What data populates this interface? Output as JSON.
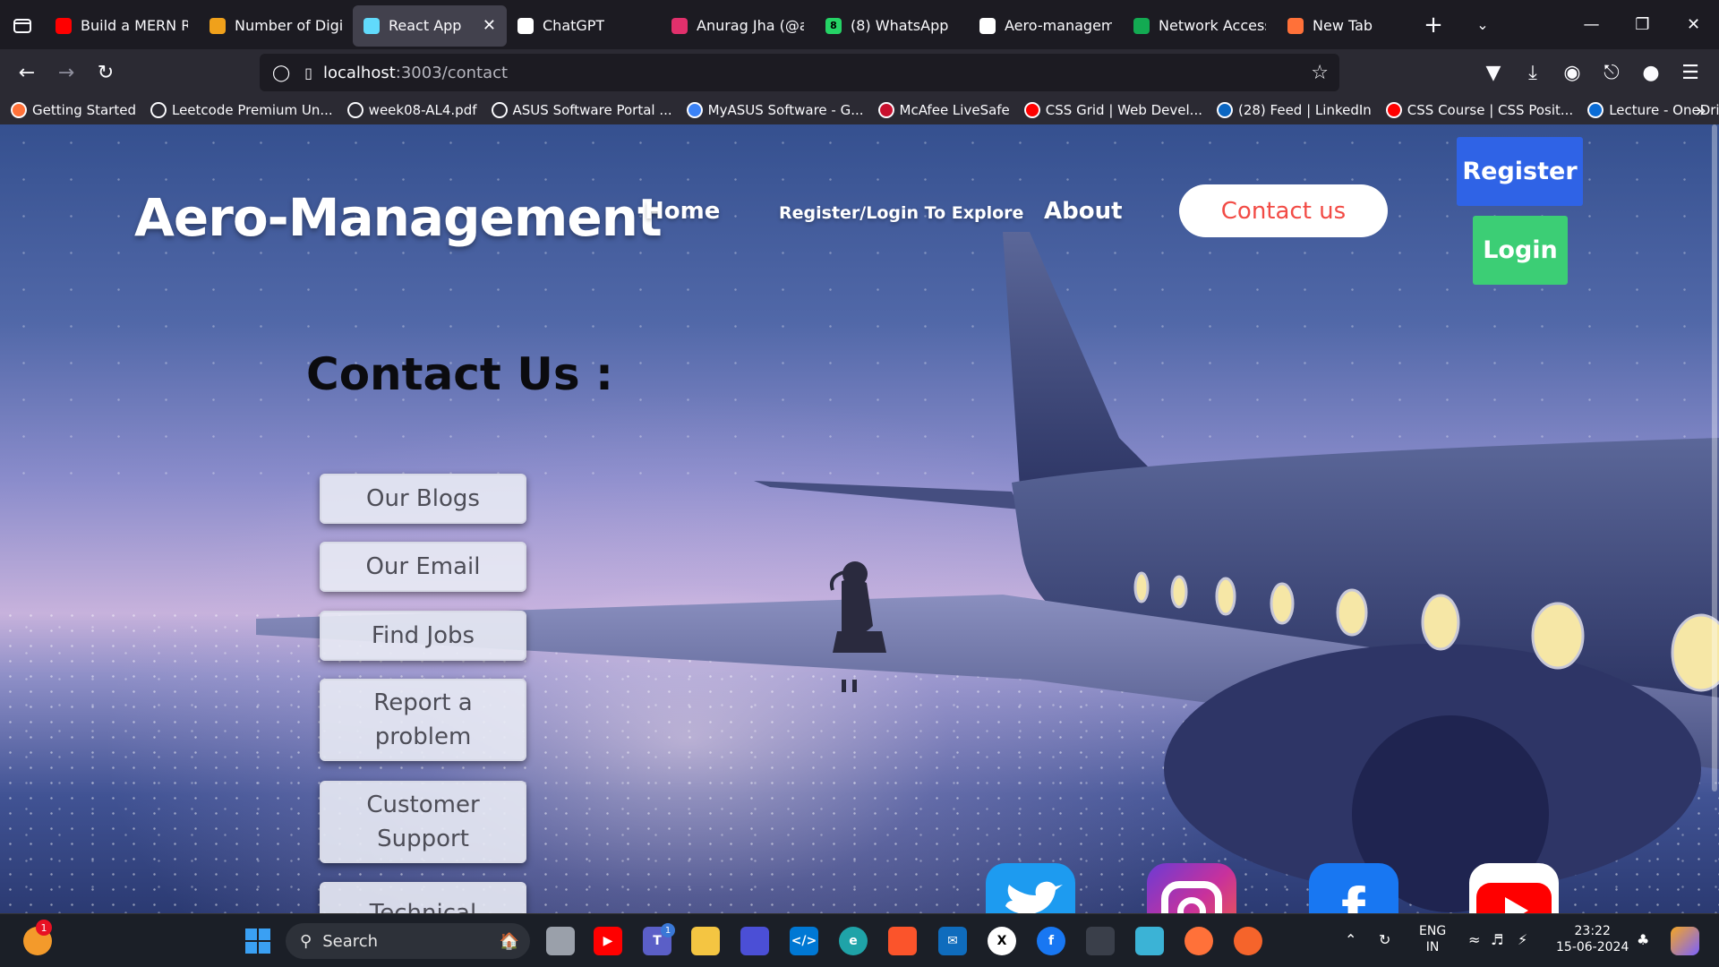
{
  "browser": {
    "tabs": [
      {
        "title": "Build a MERN Rea",
        "icon": "youtube-icon",
        "color": "#ff0000"
      },
      {
        "title": "Number of Digit",
        "icon": "leetcode-icon",
        "color": "#f0a11b"
      },
      {
        "title": "React App",
        "icon": "react-icon",
        "color": "#61dafb",
        "active": true
      },
      {
        "title": "ChatGPT",
        "icon": "chatgpt-icon",
        "color": "#ffffff"
      },
      {
        "title": "Anurag Jha (@anu",
        "icon": "instagram-icon",
        "color": "#e1306c"
      },
      {
        "title": "(8) WhatsApp",
        "icon": "whatsapp-icon",
        "color": "#25d366",
        "badge": "8"
      },
      {
        "title": "Aero-manageme",
        "icon": "github-icon",
        "color": "#ffffff"
      },
      {
        "title": "Network Access |",
        "icon": "mongodb-icon",
        "color": "#13aa52"
      },
      {
        "title": "New Tab",
        "icon": "firefox-icon",
        "color": "#ff7139"
      }
    ],
    "url_host": "localhost",
    "url_path": ":3003/contact",
    "bookmarks": [
      {
        "label": "Getting Started",
        "icon": "firefox-icon",
        "color": "#ff7139"
      },
      {
        "label": "Leetcode Premium Un...",
        "icon": "globe-icon",
        "color": "#2b2a33"
      },
      {
        "label": "week08-AL4.pdf",
        "icon": "globe-icon",
        "color": "#2b2a33"
      },
      {
        "label": "ASUS Software Portal ...",
        "icon": "globe-icon",
        "color": "#2b2a33"
      },
      {
        "label": "MyASUS Software - G...",
        "icon": "asus-icon",
        "color": "#3b82f6"
      },
      {
        "label": "McAfee LiveSafe",
        "icon": "mcafee-icon",
        "color": "#c8102e"
      },
      {
        "label": "CSS Grid | Web Devel...",
        "icon": "youtube-icon",
        "color": "#ff0000"
      },
      {
        "label": "(28) Feed | LinkedIn",
        "icon": "linkedin-icon",
        "color": "#0a66c2"
      },
      {
        "label": "CSS Course | CSS Posit...",
        "icon": "youtube-icon",
        "color": "#ff0000"
      },
      {
        "label": "Lecture - OneDrive",
        "icon": "onedrive-icon",
        "color": "#0a6cd6"
      }
    ]
  },
  "site": {
    "brand": "Aero-Management",
    "nav": {
      "home": "Home",
      "register_login": "Register/Login To Explore",
      "about": "About",
      "contact": "Contact us"
    },
    "register_button": "Register",
    "login_button": "Login",
    "heading": "Contact Us :",
    "contact_buttons": [
      "Our Blogs",
      "Our Email",
      "Find Jobs",
      "Report a problem",
      "Customer Support",
      "Technical"
    ],
    "social": [
      "twitter-icon",
      "instagram-icon",
      "facebook-icon",
      "youtube-icon"
    ],
    "colors": {
      "register": "#2f63e6",
      "login": "#3cce75",
      "contact_text": "#f24b45"
    }
  },
  "taskbar": {
    "search_placeholder": "Search",
    "language": "ENG",
    "region": "IN",
    "time": "23:22",
    "date": "15-06-2024",
    "notification_badge": "1",
    "teams_badge": "1"
  }
}
